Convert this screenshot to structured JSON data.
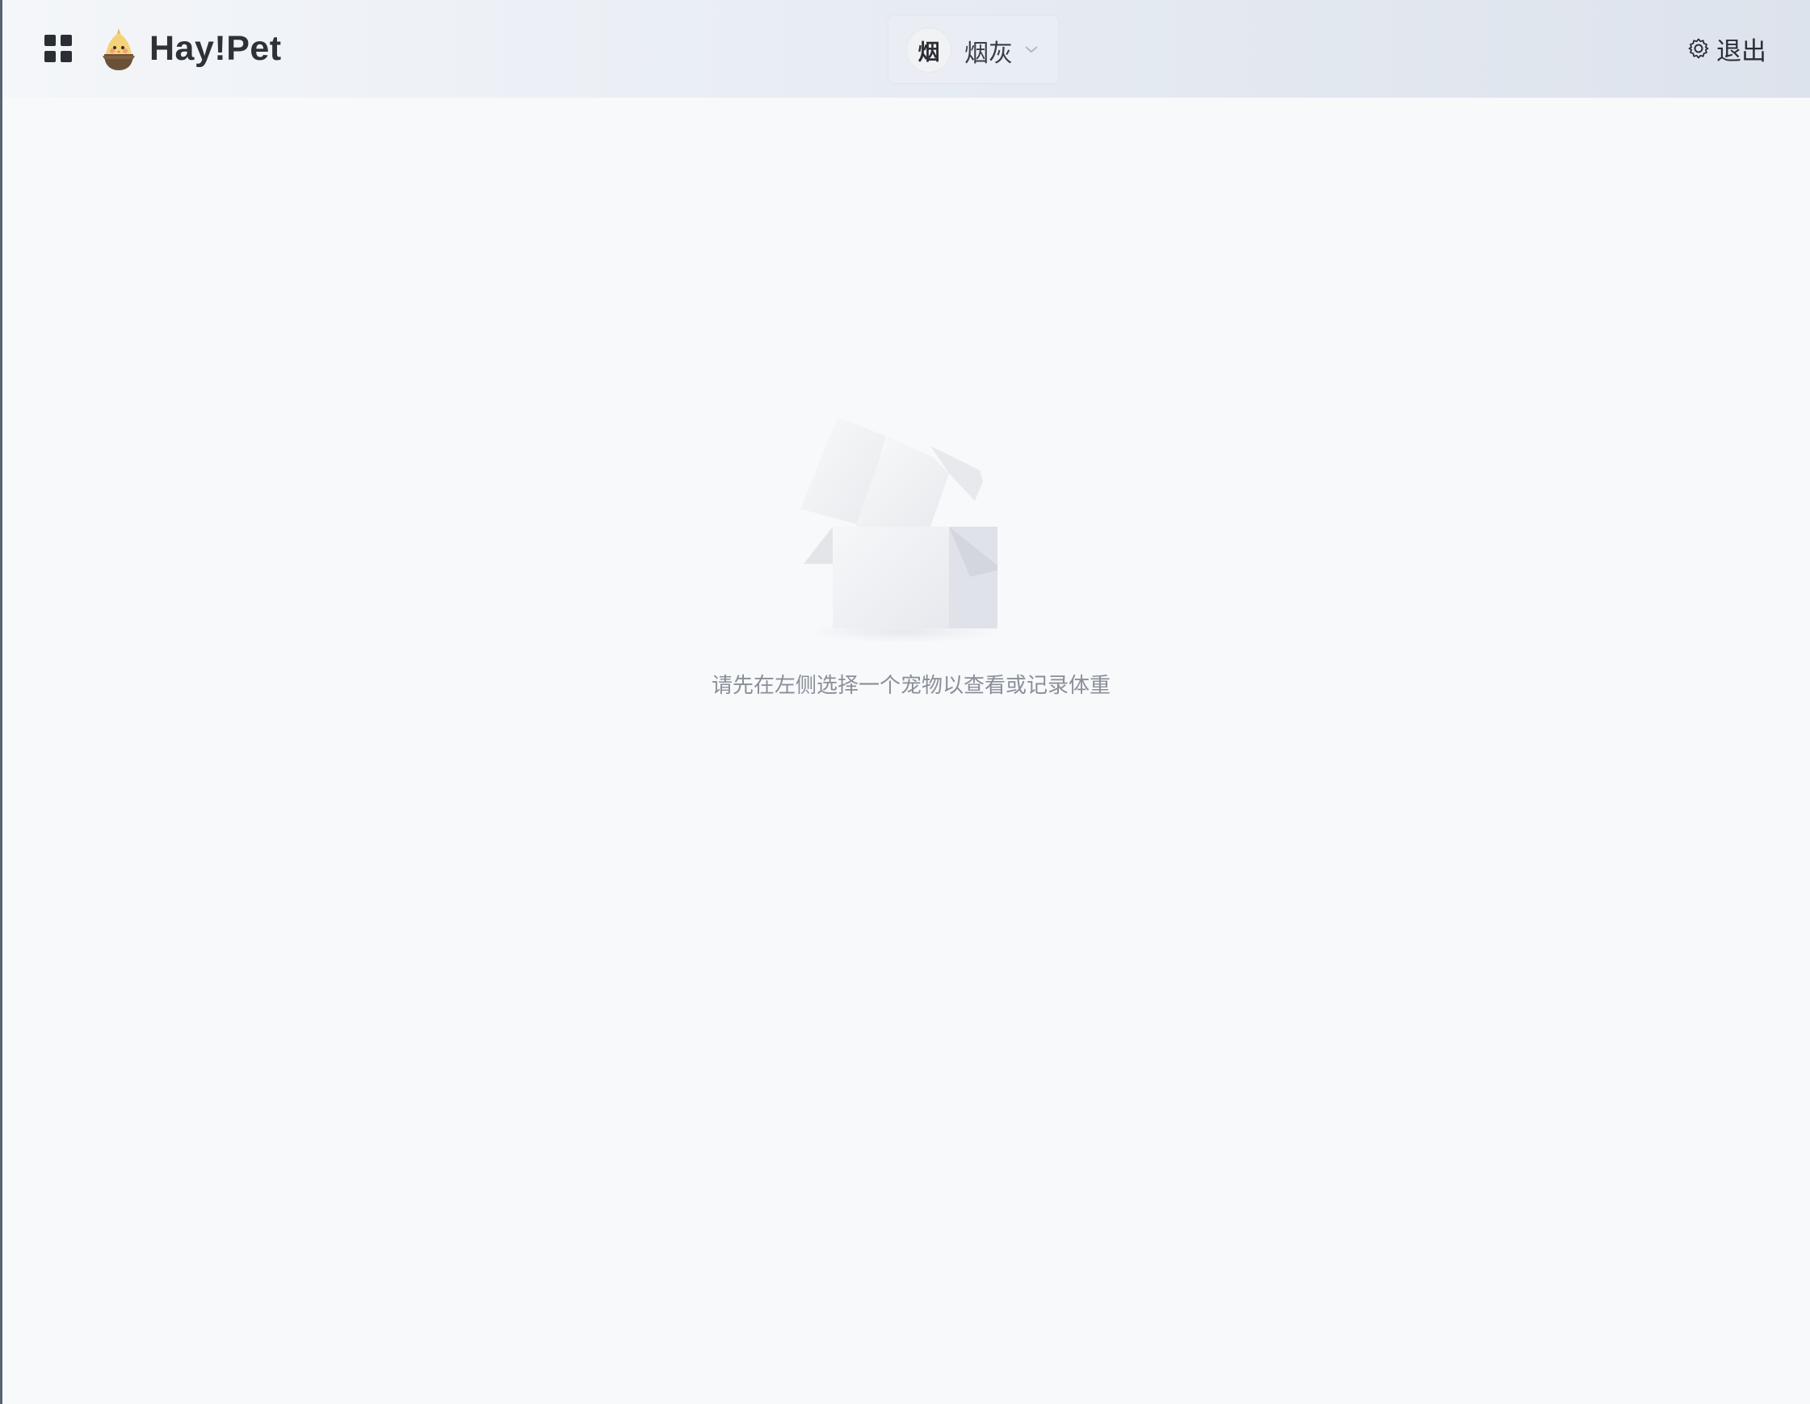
{
  "header": {
    "brand": "Hay!Pet",
    "apps_icon": "grid-icon",
    "logo_icon": "bird-logo-icon",
    "pet_selector": {
      "avatar_text": "烟",
      "selected_pet": "烟灰",
      "chevron_icon": "chevron-down-icon"
    },
    "logout": {
      "icon": "gear-icon",
      "label": "退出"
    }
  },
  "main": {
    "empty_icon": "empty-box-icon",
    "empty_message": "请先在左侧选择一个宠物以查看或记录体重"
  },
  "colors": {
    "text_dark": "#2b2e35",
    "text_muted": "#8a8f98",
    "background": "#f7f9fb"
  }
}
